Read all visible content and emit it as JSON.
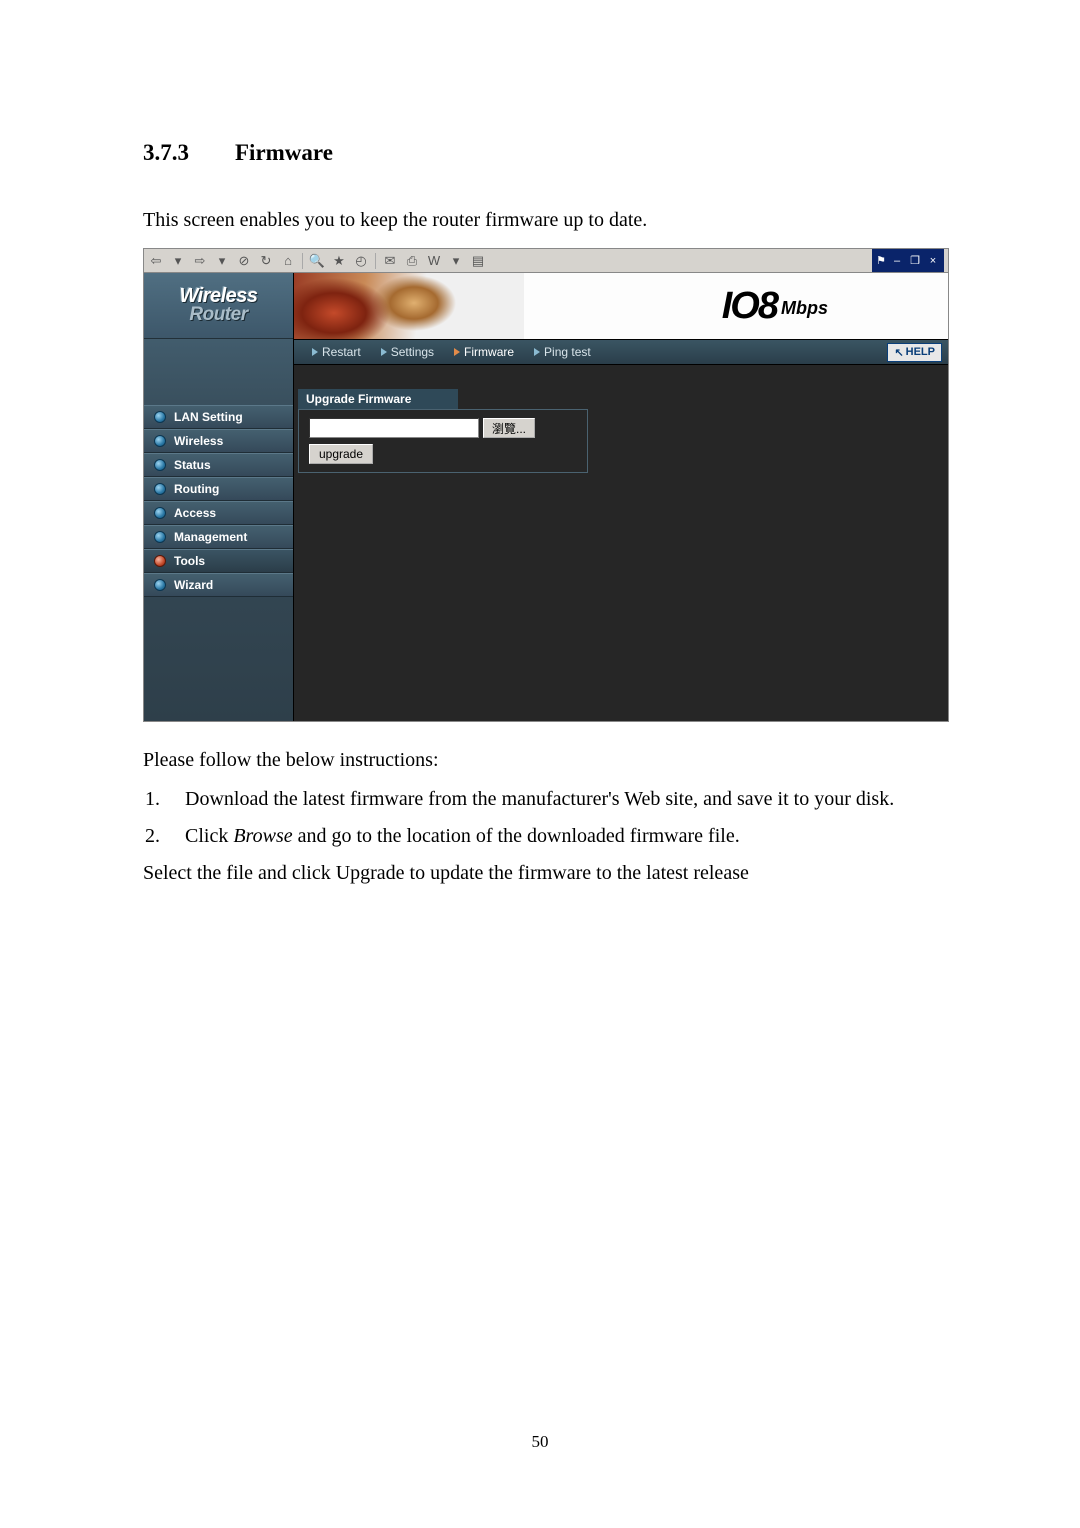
{
  "heading": {
    "number": "3.7.3",
    "title": "Firmware"
  },
  "intro": "This screen enables you to keep the router firmware up to date.",
  "toolbar_right": {
    "minimize": "–",
    "restore": "❐",
    "close": "×"
  },
  "logo": {
    "line1": "Wireless",
    "line2": "Router"
  },
  "sidebar": {
    "items": [
      {
        "label": "LAN Setting",
        "active": false
      },
      {
        "label": "Wireless",
        "active": false
      },
      {
        "label": "Status",
        "active": false
      },
      {
        "label": "Routing",
        "active": false
      },
      {
        "label": "Access",
        "active": false
      },
      {
        "label": "Management",
        "active": false
      },
      {
        "label": "Tools",
        "active": true
      },
      {
        "label": "Wizard",
        "active": false
      }
    ]
  },
  "banner": {
    "main": "IO8",
    "unit": "Mbps"
  },
  "tabs": {
    "items": [
      {
        "label": "Restart",
        "active": false
      },
      {
        "label": "Settings",
        "active": false
      },
      {
        "label": "Firmware",
        "active": true
      },
      {
        "label": "Ping test",
        "active": false
      }
    ],
    "help": "HELP"
  },
  "panel": {
    "title": "Upgrade Firmware",
    "browse": "瀏覽...",
    "upgrade": "upgrade"
  },
  "instructions": {
    "lead": "Please follow the below instructions:",
    "step1_num": "1.",
    "step1": "Download the latest firmware from the manufacturer's Web site, and save it to your disk.",
    "step2_num": "2.",
    "step2_pre": "Click ",
    "step2_em": "Browse",
    "step2_post": " and go to the location of the downloaded firmware file.",
    "final": "Select the file and click Upgrade to update the firmware to the latest release"
  },
  "page_number": "50"
}
